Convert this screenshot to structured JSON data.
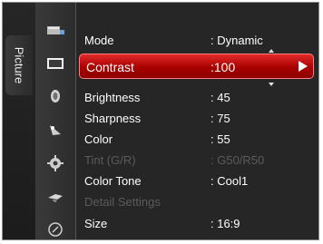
{
  "tab": {
    "label": "Picture"
  },
  "icons": [
    {
      "name": "input-icon"
    },
    {
      "name": "picture-icon"
    },
    {
      "name": "sound-icon"
    },
    {
      "name": "channel-icon"
    },
    {
      "name": "setup-icon"
    },
    {
      "name": "application-icon"
    },
    {
      "name": "support-icon"
    }
  ],
  "menu": {
    "items": [
      {
        "label": "Mode",
        "value": ": Dynamic",
        "state": "normal"
      },
      {
        "label": "Contrast",
        "value": ":100",
        "state": "selected"
      },
      {
        "label": "Brightness",
        "value": ": 45",
        "state": "normal"
      },
      {
        "label": "Sharpness",
        "value": ": 75",
        "state": "normal"
      },
      {
        "label": "Color",
        "value": ": 55",
        "state": "normal"
      },
      {
        "label": "Tint (G/R)",
        "value": ": G50/R50",
        "state": "disabled"
      },
      {
        "label": "Color Tone",
        "value": ": Cool1",
        "state": "normal"
      },
      {
        "label": "Detail Settings",
        "value": "",
        "state": "disabled"
      },
      {
        "label": "Size",
        "value": ": 16:9",
        "state": "normal"
      }
    ]
  },
  "colors": {
    "selected_highlight": "#c40000",
    "disabled_text": "#5b5b5b",
    "text": "#ffffff"
  }
}
